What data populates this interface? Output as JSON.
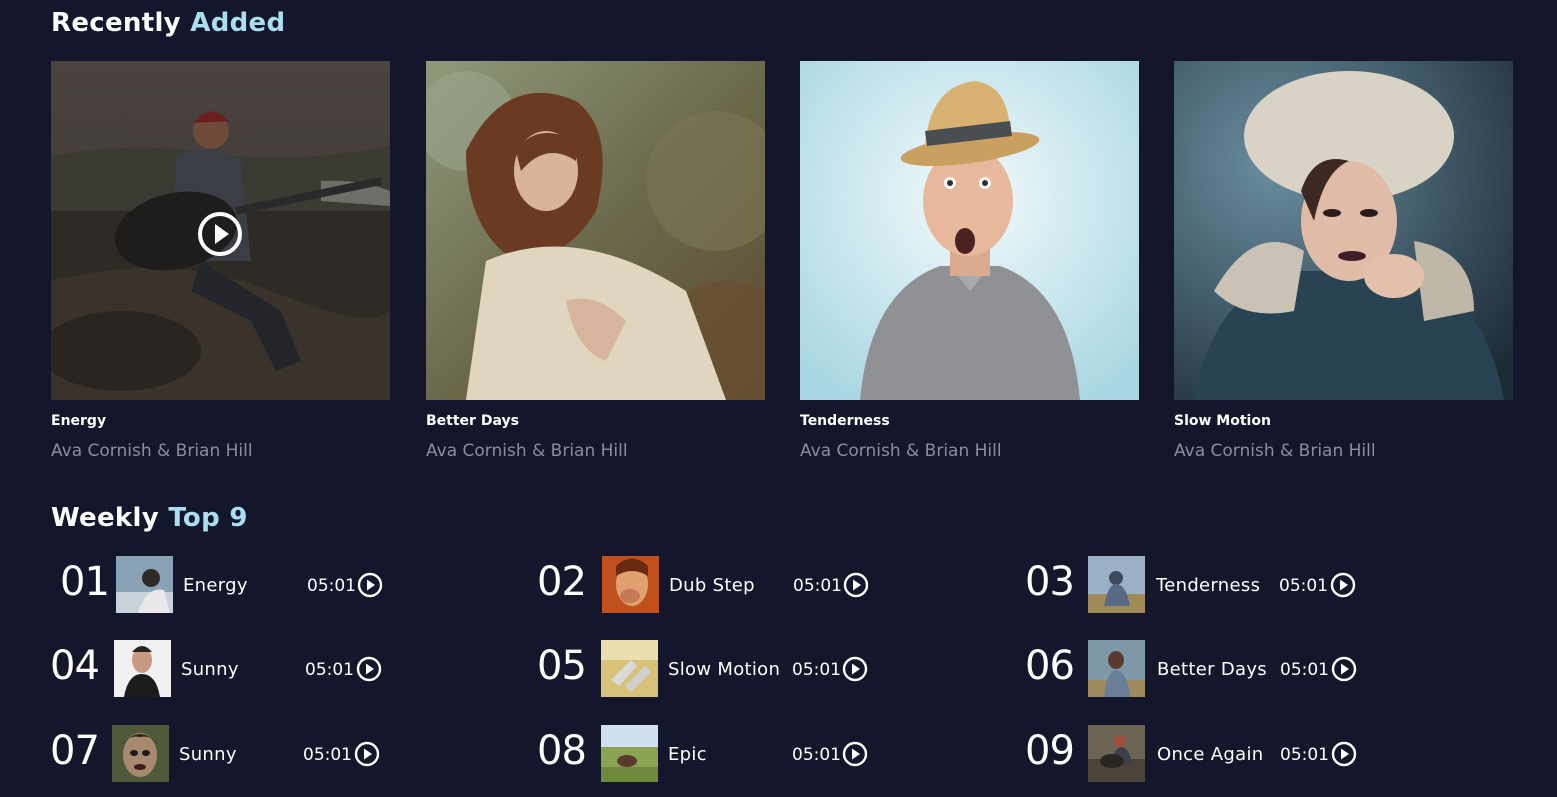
{
  "recently_added": {
    "title_word1": "Recently",
    "title_word2": "Added",
    "items": [
      {
        "title": "Energy",
        "artist": "Ava Cornish & Brian Hill"
      },
      {
        "title": "Better Days",
        "artist": "Ava Cornish & Brian Hill"
      },
      {
        "title": "Tenderness",
        "artist": "Ava Cornish & Brian Hill"
      },
      {
        "title": "Slow Motion",
        "artist": "Ava Cornish & Brian Hill"
      }
    ]
  },
  "weekly_top": {
    "title_word1": "Weekly",
    "title_word2": "Top 9",
    "items": [
      {
        "rank": "01",
        "title": "Energy",
        "duration": "05:01"
      },
      {
        "rank": "02",
        "title": "Dub Step",
        "duration": "05:01"
      },
      {
        "rank": "03",
        "title": "Tenderness",
        "duration": "05:01"
      },
      {
        "rank": "04",
        "title": "Sunny",
        "duration": "05:01"
      },
      {
        "rank": "05",
        "title": "Slow Motion",
        "duration": "05:01"
      },
      {
        "rank": "06",
        "title": "Better Days",
        "duration": "05:01"
      },
      {
        "rank": "07",
        "title": "Sunny",
        "duration": "05:01"
      },
      {
        "rank": "08",
        "title": "Epic",
        "duration": "05:01"
      },
      {
        "rank": "09",
        "title": "Once Again",
        "duration": "05:01"
      }
    ]
  },
  "colors": {
    "background": "#14172b",
    "accent": "#a9dff0",
    "muted_text": "#8a8d9b"
  },
  "icons": {
    "play": "play-circle-icon"
  }
}
